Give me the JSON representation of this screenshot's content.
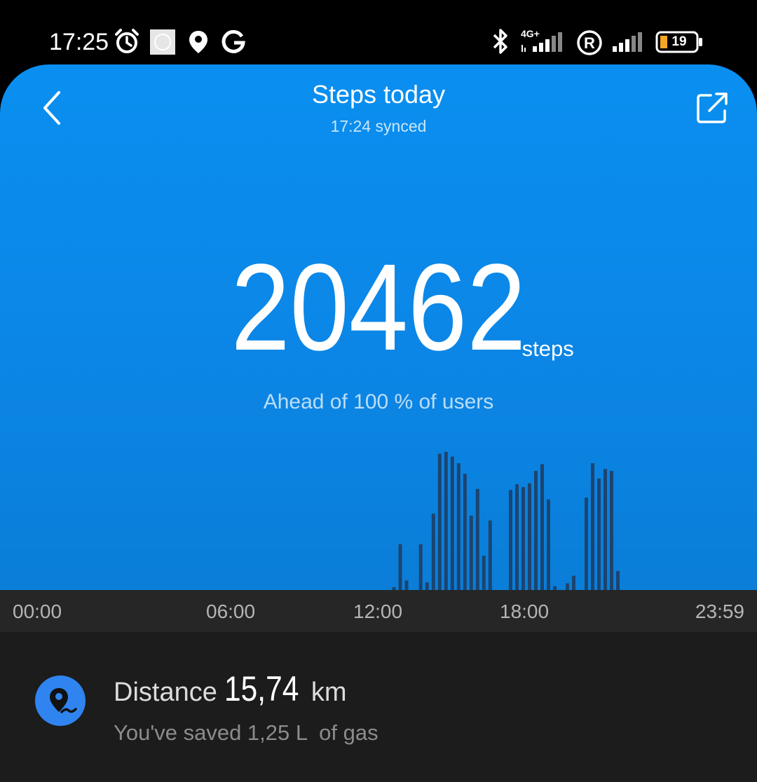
{
  "status_bar": {
    "time": "17:25",
    "network_type": "4G+",
    "battery_level": "19",
    "icons": [
      "alarm-icon",
      "mi-app-icon",
      "location-icon",
      "google-icon",
      "bluetooth-icon",
      "signal-icon",
      "roaming-icon",
      "signal-icon",
      "battery-icon"
    ]
  },
  "header": {
    "title": "Steps today",
    "sync_status": "17:24 synced",
    "back_icon": "chevron-left-icon",
    "share_icon": "share-icon"
  },
  "steps": {
    "count": "20462",
    "unit": "steps",
    "rank_text": "Ahead of 100 % of users"
  },
  "chart_data": {
    "type": "bar",
    "x_axis_labels": [
      "00:00",
      "06:00",
      "12:00",
      "18:00",
      "23:59"
    ],
    "xlim": [
      0,
      24
    ],
    "x": [
      11.6,
      11.8,
      12.0,
      12.45,
      12.65,
      12.85,
      13.05,
      13.25,
      13.45,
      13.65,
      13.85,
      14.05,
      14.25,
      14.45,
      14.65,
      15.3,
      15.5,
      15.7,
      15.9,
      16.1,
      16.3,
      16.5,
      16.7,
      17.1,
      17.3,
      17.7,
      17.9,
      18.1,
      18.3,
      18.5,
      18.7
    ],
    "values": [
      3,
      48,
      10,
      48,
      8,
      80,
      143,
      145,
      140,
      133,
      122,
      78,
      106,
      36,
      73,
      105,
      111,
      108,
      112,
      125,
      132,
      95,
      4,
      7,
      15,
      97,
      133,
      117,
      127,
      125,
      20
    ],
    "grid": false,
    "legend": "none",
    "bar_color": "#1c4470"
  },
  "axis": {
    "t0": "00:00",
    "t1": "06:00",
    "t2": "12:00",
    "t3": "18:00",
    "t4": "23:59"
  },
  "distance": {
    "label": "Distance",
    "value": "15,74",
    "unit": "km",
    "saved_text": "You've saved 1,25 L  of gas",
    "icon": "location-route-icon"
  }
}
